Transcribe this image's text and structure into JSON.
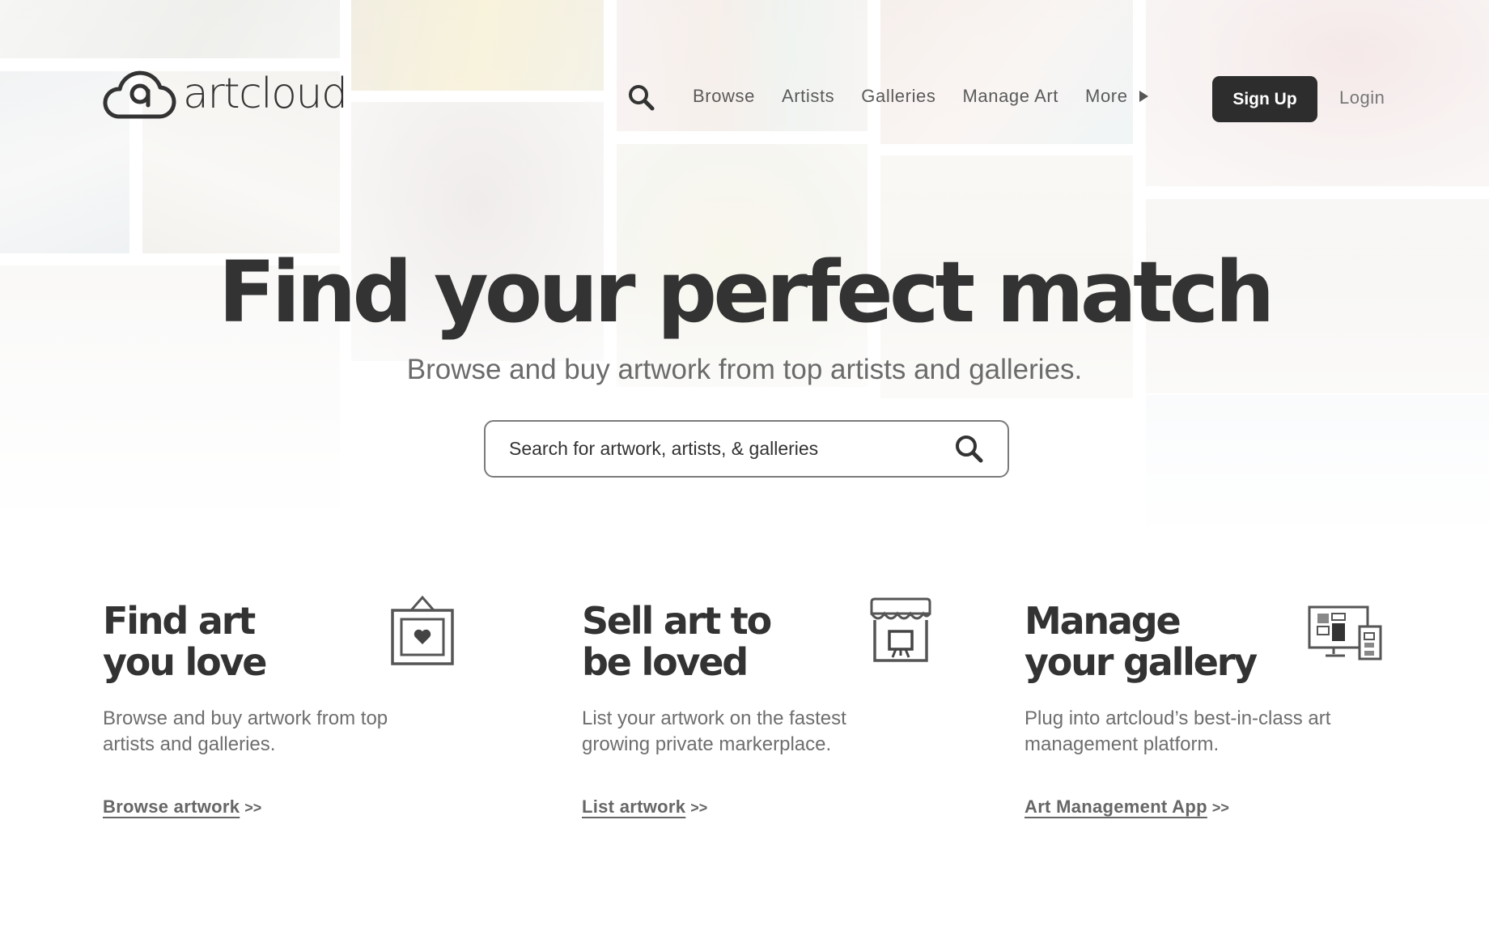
{
  "brand": {
    "name": "artcloud"
  },
  "nav": {
    "links": [
      "Browse",
      "Artists",
      "Galleries",
      "Manage Art"
    ],
    "more_label": "More",
    "signup_label": "Sign Up",
    "login_label": "Login"
  },
  "hero": {
    "title": "Find your perfect match",
    "subtitle": "Browse and buy artwork from top artists and galleries.",
    "search_placeholder": "Search for artwork, artists, & galleries"
  },
  "features": [
    {
      "title": "Find art\nyou love",
      "text": "Browse and buy artwork from top artists and galleries.",
      "link": "Browse artwork",
      "arrows": ">>",
      "icon": "framed-heart-icon"
    },
    {
      "title": "Sell art to\nbe loved",
      "text": "List your artwork on the fastest growing private markerplace.",
      "link": "List artwork",
      "arrows": ">>",
      "icon": "storefront-icon"
    },
    {
      "title": "Manage\nyour gallery",
      "text": "Plug into artcloud’s best-in-class art management platform.",
      "link": "Art Management App",
      "arrows": ">>",
      "icon": "devices-icon"
    }
  ],
  "colors": {
    "primary_button": "#2d2d2d",
    "text_dark": "#333333",
    "text_muted": "#6e6e6e"
  }
}
